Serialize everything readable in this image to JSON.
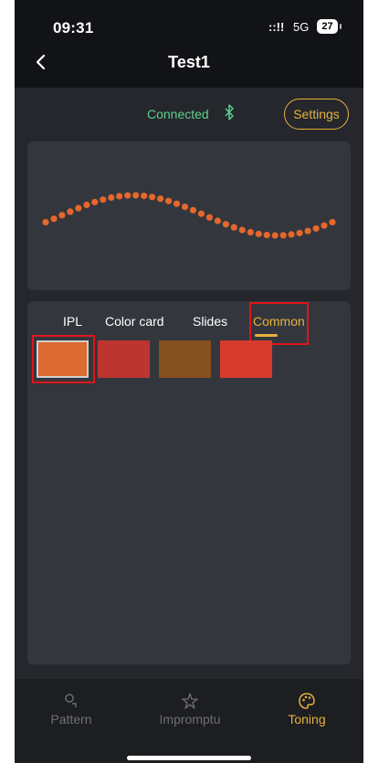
{
  "status_bar": {
    "time": "09:31",
    "signal": "::!!",
    "network": "5G",
    "battery": "27"
  },
  "header": {
    "title": "Test1"
  },
  "connection": {
    "status": "Connected",
    "settings_label": "Settings"
  },
  "tabs": [
    {
      "label": "IPL",
      "active": false
    },
    {
      "label": "Color card",
      "active": false
    },
    {
      "label": "Slides",
      "active": false
    },
    {
      "label": "Common",
      "active": true
    }
  ],
  "swatches": [
    {
      "color": "#dd6a30",
      "selected": true
    },
    {
      "color": "#bd3530",
      "selected": false
    },
    {
      "color": "#84501f",
      "selected": false
    },
    {
      "color": "#d73a2d",
      "selected": false
    }
  ],
  "wave_color": "#e5672b",
  "bottom_nav": [
    {
      "label": "Pattern",
      "icon": "pattern-icon",
      "active": false
    },
    {
      "label": "Impromptu",
      "icon": "impromptu-icon",
      "active": false
    },
    {
      "label": "Toning",
      "icon": "palette-icon",
      "active": true
    }
  ],
  "accent_color": "#e6b23b",
  "connected_color": "#5cd08a"
}
